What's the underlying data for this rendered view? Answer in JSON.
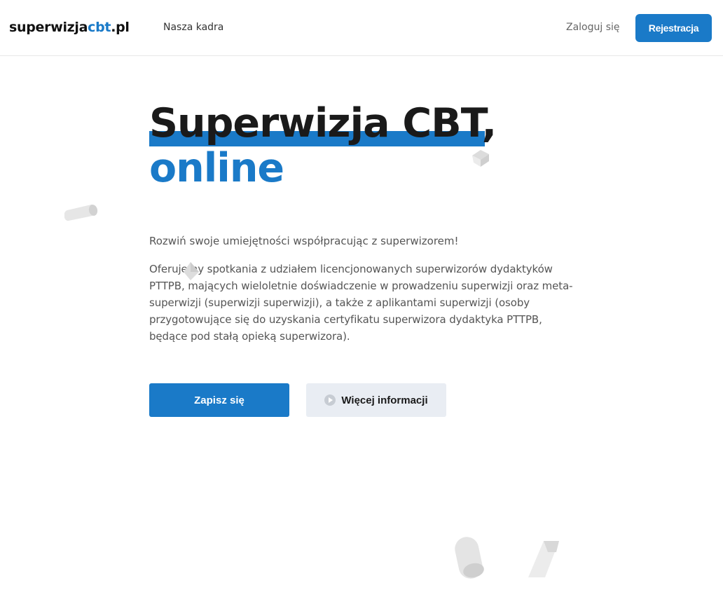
{
  "header": {
    "logo_part1": "superwizja",
    "logo_part2": "cbt",
    "logo_part3": ".pl",
    "nav_team": "Nasza kadra",
    "login": "Zaloguj się",
    "register": "Rejestracja"
  },
  "hero": {
    "title_line1": "Superwizja CBT,",
    "title_line2": "online",
    "lead": "Rozwiń swoje umiejętności współpracując z superwizorem!",
    "description": "Oferujemy spotkania z udziałem licencjonowanych superwizorów dydaktyków PTTPB, mających wieloletnie doświadczenie w prowadzeniu superwizji oraz meta-superwizji (superwizji superwizji), a także z aplikantami superwizji (osoby przygotowujące się do uzyskania certyfikatu superwizora dydaktyka PTTPB, będące pod stałą opieką superwizora).",
    "cta_primary": "Zapisz się",
    "cta_secondary": "Więcej informacji"
  },
  "colors": {
    "brand": "#1a7ac8",
    "text": "#1a1a1a",
    "muted": "#555555",
    "secondary_button_bg": "#e9edf3"
  },
  "decorations": [
    "cylinder-shape",
    "cube-shape",
    "cone-shape",
    "pill-shape",
    "prism-shape"
  ]
}
